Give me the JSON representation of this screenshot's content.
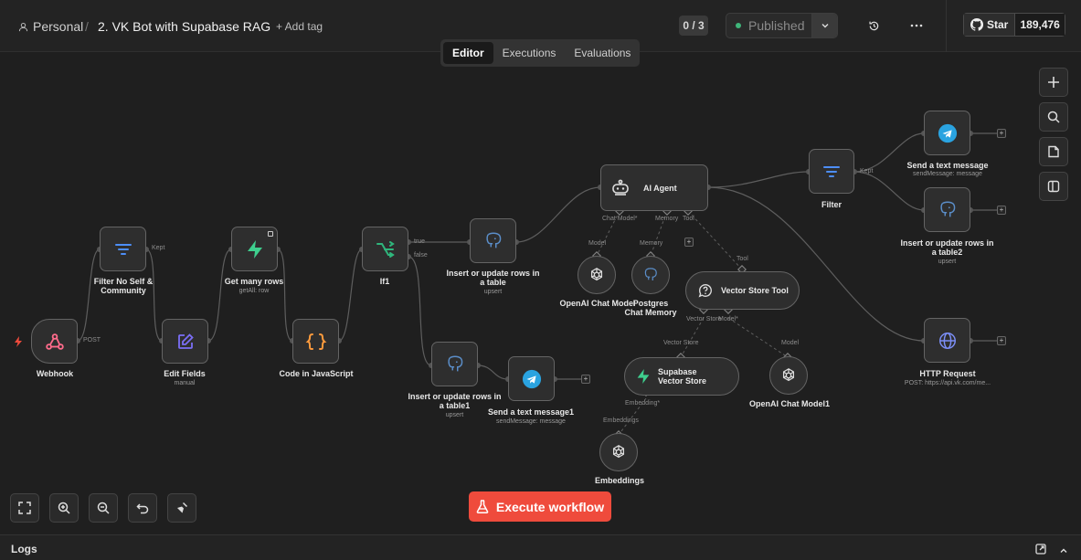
{
  "header": {
    "breadcrumb_project": "Personal",
    "breadcrumb_sep": "/",
    "workflow_title": "2. VK Bot with Supabase RAG",
    "add_tag": "+ Add tag",
    "counter": "0 / 3",
    "published_label": "Published",
    "github_star": "Star",
    "github_count": "189,476"
  },
  "tabs": [
    "Editor",
    "Executions",
    "Evaluations"
  ],
  "nodes": {
    "webhook": {
      "label": "Webhook"
    },
    "filter_no_self": {
      "label": "Filter No Self & Community"
    },
    "edit_fields": {
      "label": "Edit Fields",
      "sub": "manual"
    },
    "get_many_rows": {
      "label": "Get many rows",
      "sub": "getAll: row"
    },
    "code_js": {
      "label": "Code in JavaScript"
    },
    "if1": {
      "label": "If1"
    },
    "insert_update": {
      "label": "Insert or update rows in a table",
      "sub": "upsert"
    },
    "insert_update1": {
      "label": "Insert or update rows in a table1",
      "sub": "upsert"
    },
    "send_text1": {
      "label": "Send a text message1",
      "sub": "sendMessage: message"
    },
    "ai_agent": {
      "label": "AI Agent"
    },
    "openai_chat": {
      "label": "OpenAI Chat Model"
    },
    "postgres_mem": {
      "label": "Postgres Chat Memory"
    },
    "vector_tool": {
      "label": "Vector Store Tool"
    },
    "supabase_vs": {
      "label": "Supabase Vector Store"
    },
    "openai_chat1": {
      "label": "OpenAI Chat Model1"
    },
    "embeddings": {
      "label": "Embeddings"
    },
    "filter": {
      "label": "Filter"
    },
    "send_text": {
      "label": "Send a text message",
      "sub": "sendMessage: message"
    },
    "insert_update2": {
      "label": "Insert or update rows in a table2",
      "sub": "upsert"
    },
    "http_request": {
      "label": "HTTP Request",
      "sub": "POST: https://api.vk.com/me..."
    }
  },
  "port_labels": {
    "post": "POST",
    "kept1": "Kept",
    "kept2": "Kept",
    "true": "true",
    "false": "false",
    "chat_model": "Chat Model*",
    "memory": "Memory",
    "tool": "Tool",
    "model_a": "Model",
    "memory_b": "Memory",
    "tool_b": "Tool",
    "vector_store": "Vector Store",
    "model_star": "Model*",
    "vector_store_b": "Vector Store",
    "model_c": "Model",
    "embedding": "Embedding*",
    "embeddings_b": "Embeddings"
  },
  "execute_label": "Execute workflow",
  "logs_label": "Logs",
  "colors": {
    "accent": "#ef4b3c",
    "published_dot": "#3fb67a",
    "webhook": "#ff6b8b",
    "filter": "#4d8ef7",
    "edit": "#7b6ef6",
    "supabase": "#3ecf8e",
    "code": "#ff9b3d",
    "if": "#2fb67c",
    "telegram": "#2aa3e0",
    "postgres": "#5b8ec9"
  }
}
